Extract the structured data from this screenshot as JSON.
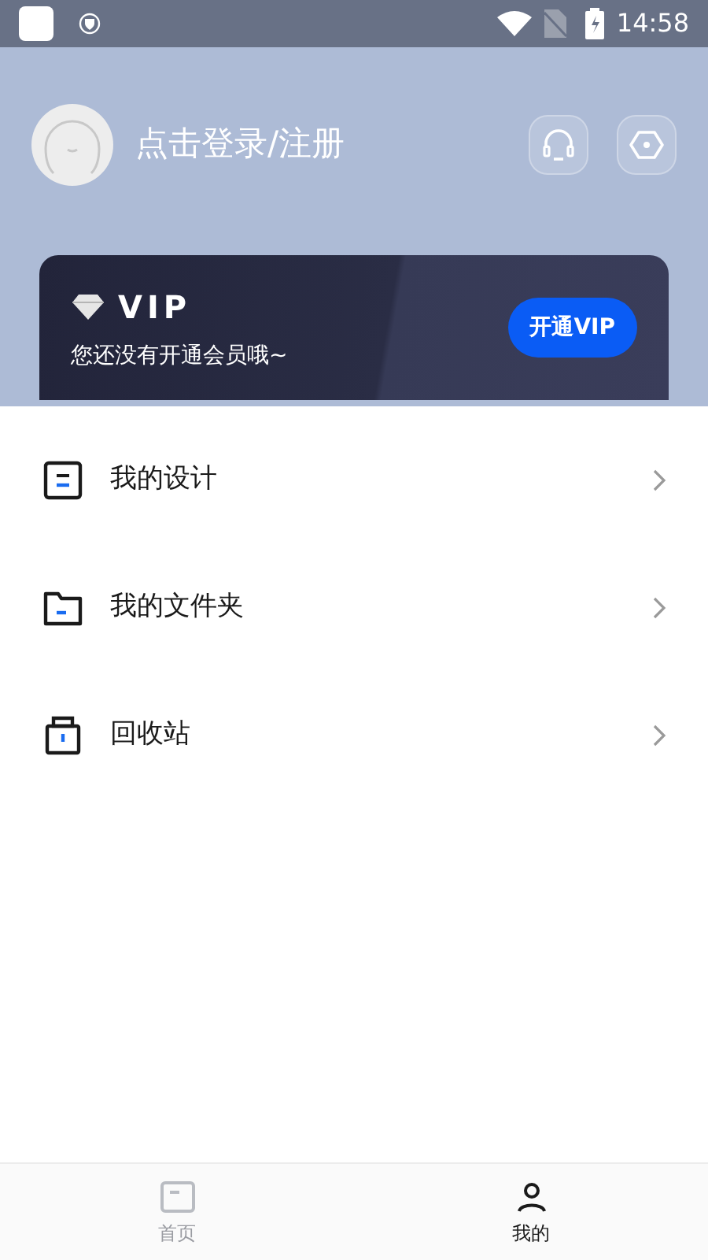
{
  "status_bar": {
    "time": "14:58"
  },
  "profile": {
    "login_text": "点击登录/注册"
  },
  "vip": {
    "title": "VIP",
    "subtitle": "您还没有开通会员哦~",
    "button": "开通VIP"
  },
  "menu": [
    {
      "kind": "design",
      "label": "我的设计"
    },
    {
      "kind": "folder",
      "label": "我的文件夹"
    },
    {
      "kind": "trash",
      "label": "回收站"
    }
  ],
  "bottom_nav": [
    {
      "kind": "home",
      "label": "首页",
      "selected": false
    },
    {
      "kind": "me",
      "label": "我的",
      "selected": true
    }
  ]
}
